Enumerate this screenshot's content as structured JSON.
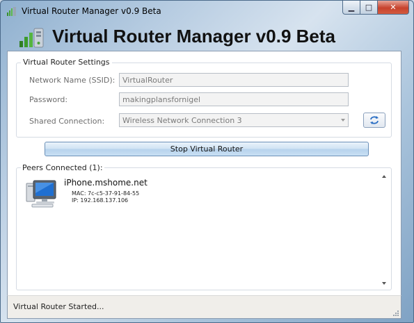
{
  "window": {
    "title": "Virtual Router Manager v0.9 Beta"
  },
  "header": {
    "title": "Virtual Router Manager v0.9 Beta"
  },
  "settings": {
    "legend": "Virtual Router Settings",
    "ssid_label": "Network Name (SSID):",
    "ssid_value": "VirtualRouter",
    "password_label": "Password:",
    "password_value": "makingplansfornigel",
    "shared_label": "Shared Connection:",
    "shared_value": "Wireless Network Connection 3"
  },
  "actions": {
    "stop_label": "Stop Virtual Router"
  },
  "peers": {
    "legend": "Peers Connected (1):",
    "items": [
      {
        "hostname": "iPhone.mshome.net",
        "mac": "MAC: 7c-c5-37-91-84-55",
        "ip": "IP: 192.168.137.106"
      }
    ]
  },
  "status": {
    "text": "Virtual Router Started..."
  }
}
